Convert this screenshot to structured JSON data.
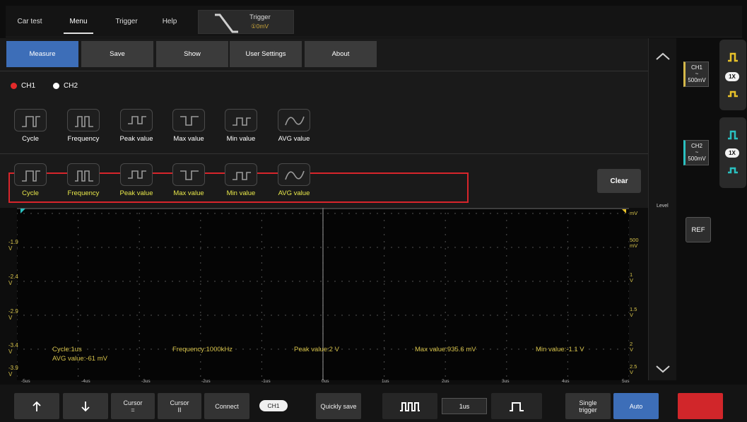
{
  "top_tabs": [
    "Car test",
    "Menu",
    "Trigger",
    "Help"
  ],
  "trigger": {
    "title": "Trigger",
    "value": "①0mV"
  },
  "menu_buttons": [
    "Measure",
    "Save",
    "Show",
    "User Settings",
    "About"
  ],
  "channels": [
    {
      "label": "CH1",
      "color": "#e42a2a"
    },
    {
      "label": "CH2",
      "color": "#ffffff"
    }
  ],
  "measure_options": [
    "Cycle",
    "Frequency",
    "Peak value",
    "Max value",
    "Min value",
    "AVG value"
  ],
  "selected_measures": [
    "Cycle",
    "Frequency",
    "Peak value",
    "Max value",
    "Min value",
    "AVG value"
  ],
  "clear_label": "Clear",
  "scope": {
    "left_levels": [
      "-1.9\nV",
      "-2.4\nV",
      "-2.9\nV",
      "-3.4\nV",
      "-3.9\nV"
    ],
    "right_levels": [
      "mV",
      "500\nmV",
      "1\nV",
      "1.5\nV",
      "2\nV",
      "2.5\nV"
    ],
    "x_ticks": [
      "-5us",
      "-4us",
      "-3us",
      "-2us",
      "-1us",
      "0us",
      "1us",
      "2us",
      "3us",
      "4us",
      "5us"
    ],
    "measurements": {
      "cycle": "Cycle:1us",
      "avg": "AVG value:-61  mV",
      "frequency": "Frequency:1000kHz",
      "peak": "Peak value:2  V",
      "max": "Max value:935.6  mV",
      "min": "Min value:-1.1  V"
    }
  },
  "level_label": "Level",
  "right": {
    "ch1": {
      "label": "CH1",
      "sub": "~",
      "volt": "500mV",
      "probe": "1X"
    },
    "ch2": {
      "label": "CH2",
      "sub": "~",
      "volt": "500mV",
      "probe": "1X"
    },
    "ref": "REF"
  },
  "bottom": {
    "cursor_eq": "Cursor\n=",
    "cursor_ii": "Cursor\nII",
    "connect": "Connect",
    "channel": "CH1",
    "quick_save": "Quickly save",
    "timebase": "1us",
    "single_trigger": "Single\ntrigger",
    "auto": "Auto"
  },
  "colors": {
    "accent": "#3d6eb8",
    "measure_text": "#d6c24a",
    "highlight": "#d8252b"
  }
}
